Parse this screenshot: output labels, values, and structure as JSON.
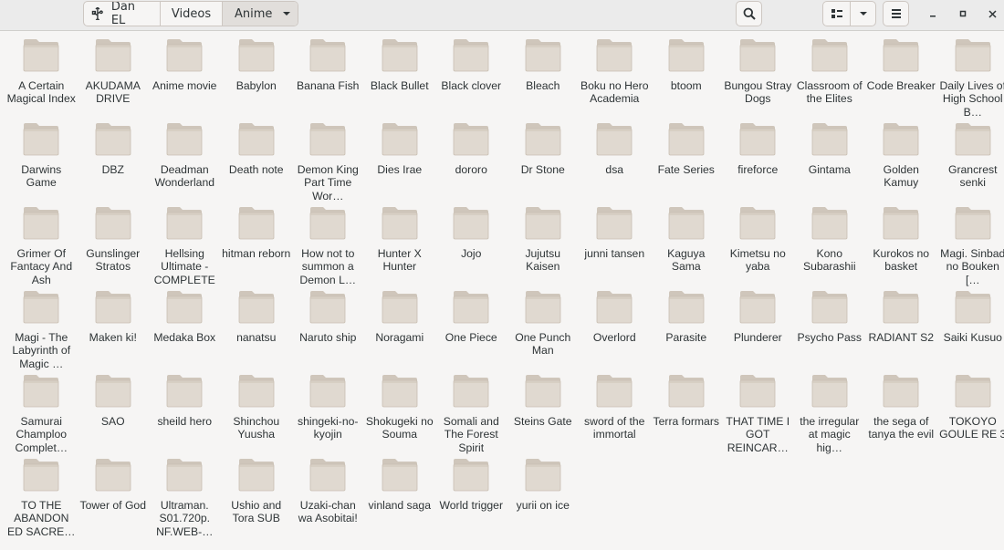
{
  "breadcrumb": {
    "home": "Dan EL",
    "videos": "Videos",
    "current": "Anime"
  },
  "icons": {
    "home": "usb-drive-icon",
    "search": "search-icon",
    "view": "icon-view-icon",
    "view_dropdown": "chevron-down-icon",
    "menu": "hamburger-menu-icon",
    "minimize": "minimize-icon",
    "maximize": "maximize-icon",
    "close": "close-icon",
    "folder": "folder-icon"
  },
  "colors": {
    "folder_body": "#e0d9d0",
    "folder_tab": "#cfc6bb",
    "background": "#f6f5f4"
  },
  "folders": [
    "A Certain Magical Index",
    "AKUDAMA DRIVE",
    "Anime movie",
    "Babylon",
    "Banana Fish",
    "Black Bullet",
    "Black clover",
    "Bleach",
    "Boku no Hero Academia",
    "btoom",
    "Bungou Stray Dogs",
    "Classroom of the Elites",
    "Code Breaker",
    "Daily Lives of High School B…",
    "Darwins Game",
    "DBZ",
    "Deadman Wonderland",
    "Death note",
    "Demon King Part Time Wor…",
    "Dies Irae",
    "dororo",
    "Dr Stone",
    "dsa",
    "Fate Series",
    "fireforce",
    "Gintama",
    "Golden Kamuy",
    "Grancrest senki",
    "Grimer Of Fantacy And Ash",
    "Gunslinger Stratos",
    "Hellsing Ultimate - COMPLETE",
    "hitman reborn",
    "How not to summon a Demon L…",
    "Hunter X Hunter",
    "Jojo",
    "Jujutsu Kaisen",
    "junni tansen",
    "Kaguya Sama",
    "Kimetsu no yaba",
    "Kono Subarashii",
    "Kurokos no basket",
    "Magi. Sinbad no Bouken […",
    "Magi - The Labyrinth of Magic …",
    "Maken ki!",
    "Medaka Box",
    "nanatsu",
    "Naruto ship",
    "Noragami",
    "One Piece",
    "One Punch Man",
    "Overlord",
    "Parasite",
    "Plunderer",
    "Psycho Pass",
    "RADIANT S2",
    "Saiki Kusuo",
    "Samurai Champloo Complet…",
    "SAO",
    "sheild hero",
    "Shinchou Yuusha",
    "shingeki-no-kyojin",
    "Shokugeki no Souma",
    "Somali and The Forest Spirit",
    "Steins Gate",
    "sword of the immortal",
    "Terra formars",
    "THAT TIME I GOT REINCAR…",
    "the irregular at magic hig…",
    "the sega of tanya the evil",
    "TOKOYO GOULE RE 3",
    "TO THE ABANDON ED SACRE…",
    "Tower of God",
    "Ultraman. S01.720p. NF.WEB-…",
    "Ushio and Tora SUB",
    "Uzaki-chan wa Asobitai!",
    "vinland saga",
    "World trigger",
    "yurii on ice"
  ]
}
